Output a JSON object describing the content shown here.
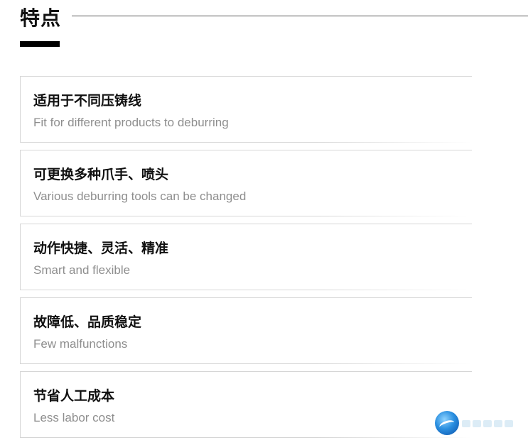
{
  "section": {
    "title": "特点"
  },
  "features": [
    {
      "title": "适用于不同压铸线",
      "subtitle": "Fit for different products to deburring"
    },
    {
      "title": "可更换多种爪手、喷头",
      "subtitle": "Various deburring tools can be changed"
    },
    {
      "title": "动作快捷、灵活、精准",
      "subtitle": "Smart and flexible"
    },
    {
      "title": "故障低、品质稳定",
      "subtitle": "Few malfunctions"
    },
    {
      "title": "节省人工成本",
      "subtitle": "Less labor cost"
    }
  ],
  "watermark": {
    "logo_icon": "globe-logo-icon"
  }
}
